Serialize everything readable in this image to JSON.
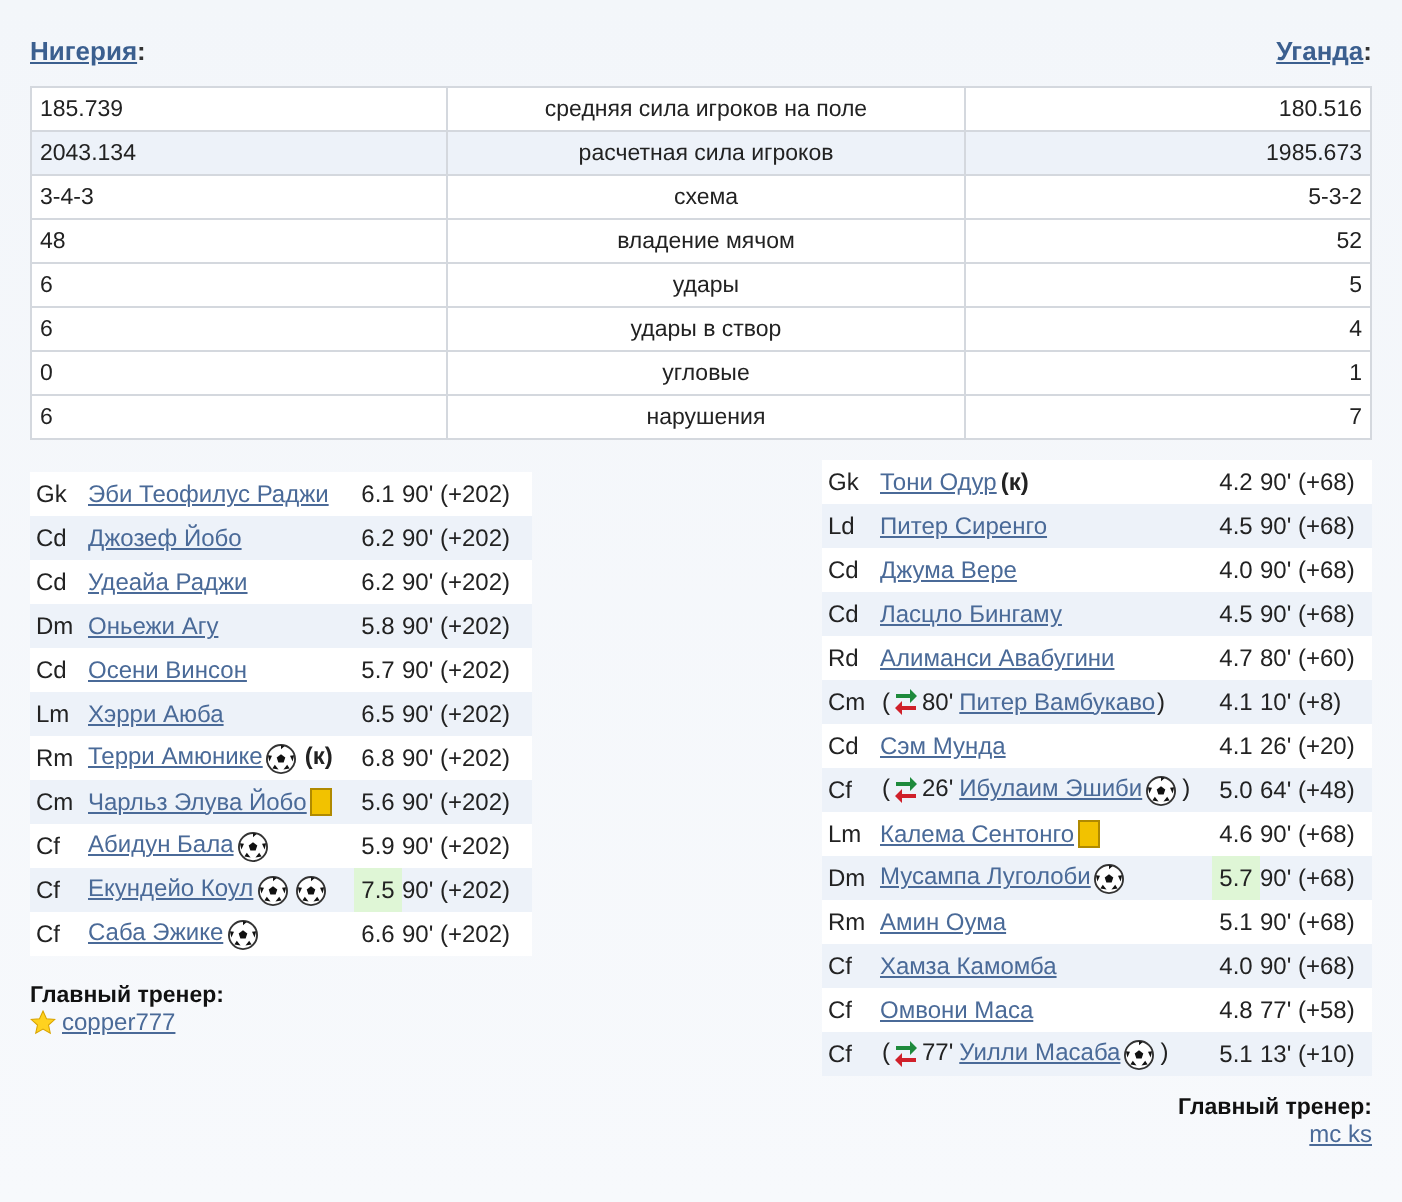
{
  "teams": [
    {
      "name": "Нигерия",
      "colon": ":"
    },
    {
      "name": "Уганда",
      "colon": ":"
    }
  ],
  "stats": [
    {
      "home": "185.739",
      "label": "средняя сила игроков на поле",
      "away": "180.516",
      "highlighted": false
    },
    {
      "home": "2043.134",
      "label": "расчетная сила игроков",
      "away": "1985.673",
      "highlighted": true
    },
    {
      "home": "3-4-3",
      "label": "схема",
      "away": "5-3-2",
      "highlighted": false
    },
    {
      "home": "48",
      "label": "владение мячом",
      "away": "52",
      "highlighted": false
    },
    {
      "home": "6",
      "label": "удары",
      "away": "5",
      "highlighted": false
    },
    {
      "home": "6",
      "label": "удары в створ",
      "away": "4",
      "highlighted": false
    },
    {
      "home": "0",
      "label": "угловые",
      "away": "1",
      "highlighted": false
    },
    {
      "home": "6",
      "label": "нарушения",
      "away": "7",
      "highlighted": false
    }
  ],
  "lineups": [
    {
      "players": [
        {
          "pos": "Gk",
          "name": "Эби Теофилус Раджи",
          "rating": "6.1",
          "best": false,
          "time": "90' (+202)"
        },
        {
          "pos": "Cd",
          "name": "Джозеф Йобо",
          "rating": "6.2",
          "best": false,
          "time": "90' (+202)"
        },
        {
          "pos": "Cd",
          "name": "Удеайа Раджи",
          "rating": "6.2",
          "best": false,
          "time": "90' (+202)"
        },
        {
          "pos": "Dm",
          "name": "Оньежи Агу",
          "rating": "5.8",
          "best": false,
          "time": "90' (+202)"
        },
        {
          "pos": "Cd",
          "name": "Осени Винсон",
          "rating": "5.7",
          "best": false,
          "time": "90' (+202)"
        },
        {
          "pos": "Lm",
          "name": "Хэрри Аюба",
          "rating": "6.5",
          "best": false,
          "time": "90' (+202)"
        },
        {
          "pos": "Rm",
          "name": "Терри Амюнике",
          "icons": [
            {
              "kind": "goal"
            }
          ],
          "captain": "(к)",
          "rating": "6.8",
          "best": false,
          "time": "90' (+202)"
        },
        {
          "pos": "Cm",
          "name": "Чарльз Элува Йобо",
          "icons": [
            {
              "kind": "booking"
            }
          ],
          "rating": "5.6",
          "best": false,
          "time": "90' (+202)"
        },
        {
          "pos": "Cf",
          "name": "Абидун Бала",
          "icons": [
            {
              "kind": "goal"
            }
          ],
          "rating": "5.9",
          "best": false,
          "time": "90' (+202)"
        },
        {
          "pos": "Cf",
          "name": "Екундейо Коул",
          "icons": [
            {
              "kind": "goal"
            },
            {
              "kind": "goal"
            }
          ],
          "rating": "7.5",
          "best": true,
          "time": "90' (+202)"
        },
        {
          "pos": "Cf",
          "name": "Саба Эжике",
          "icons": [
            {
              "kind": "goal"
            }
          ],
          "rating": "6.6",
          "best": false,
          "time": "90' (+202)"
        }
      ],
      "coach": {
        "title": "Главный тренер:",
        "name": "copper777",
        "star": true
      }
    },
    {
      "players": [
        {
          "pos": "Gk",
          "name": "Тони Одур",
          "captain": "(к)",
          "rating": "4.2",
          "best": false,
          "time": "90' (+68)"
        },
        {
          "pos": "Ld",
          "name": "Питер Сиренго",
          "rating": "4.5",
          "best": false,
          "time": "90' (+68)"
        },
        {
          "pos": "Cd",
          "name": "Джума Вере",
          "rating": "4.0",
          "best": false,
          "time": "90' (+68)"
        },
        {
          "pos": "Cd",
          "name": "Ласцло Бингаму",
          "rating": "4.5",
          "best": false,
          "time": "90' (+68)"
        },
        {
          "pos": "Rd",
          "name": "Алиманси Авабугини",
          "rating": "4.7",
          "best": false,
          "time": "80' (+60)"
        },
        {
          "pos": "Cm",
          "sub": {
            "open": "(",
            "minute": "80'",
            "close": ")"
          },
          "name": "Питер Вамбукаво",
          "rating": "4.1",
          "best": false,
          "time": "10' (+8)"
        },
        {
          "pos": "Cd",
          "name": "Сэм Мунда",
          "rating": "4.1",
          "best": false,
          "time": "26' (+20)"
        },
        {
          "pos": "Cf",
          "sub": {
            "open": "(",
            "minute": "26'",
            "close": ")"
          },
          "name": "Ибулаим Эшиби",
          "icons": [
            {
              "kind": "goal"
            }
          ],
          "rating": "5.0",
          "best": false,
          "time": "64' (+48)"
        },
        {
          "pos": "Lm",
          "name": "Калема Сентонго",
          "icons": [
            {
              "kind": "booking"
            }
          ],
          "rating": "4.6",
          "best": false,
          "time": "90' (+68)"
        },
        {
          "pos": "Dm",
          "name": "Мусампа Луголоби",
          "icons": [
            {
              "kind": "goal"
            }
          ],
          "rating": "5.7",
          "best": true,
          "time": "90' (+68)"
        },
        {
          "pos": "Rm",
          "name": "Амин Оума",
          "rating": "5.1",
          "best": false,
          "time": "90' (+68)"
        },
        {
          "pos": "Cf",
          "name": "Хамза Камомба",
          "rating": "4.0",
          "best": false,
          "time": "90' (+68)"
        },
        {
          "pos": "Cf",
          "name": "Омвони Маса",
          "rating": "4.8",
          "best": false,
          "time": "77' (+58)"
        },
        {
          "pos": "Cf",
          "sub": {
            "open": "(",
            "minute": "77'",
            "close": ")"
          },
          "name": "Уилли Масаба",
          "icons": [
            {
              "kind": "goal"
            }
          ],
          "rating": "5.1",
          "best": false,
          "time": "13' (+10)"
        }
      ],
      "coach": {
        "title": "Главный тренер:",
        "name": "mc ks"
      }
    }
  ]
}
